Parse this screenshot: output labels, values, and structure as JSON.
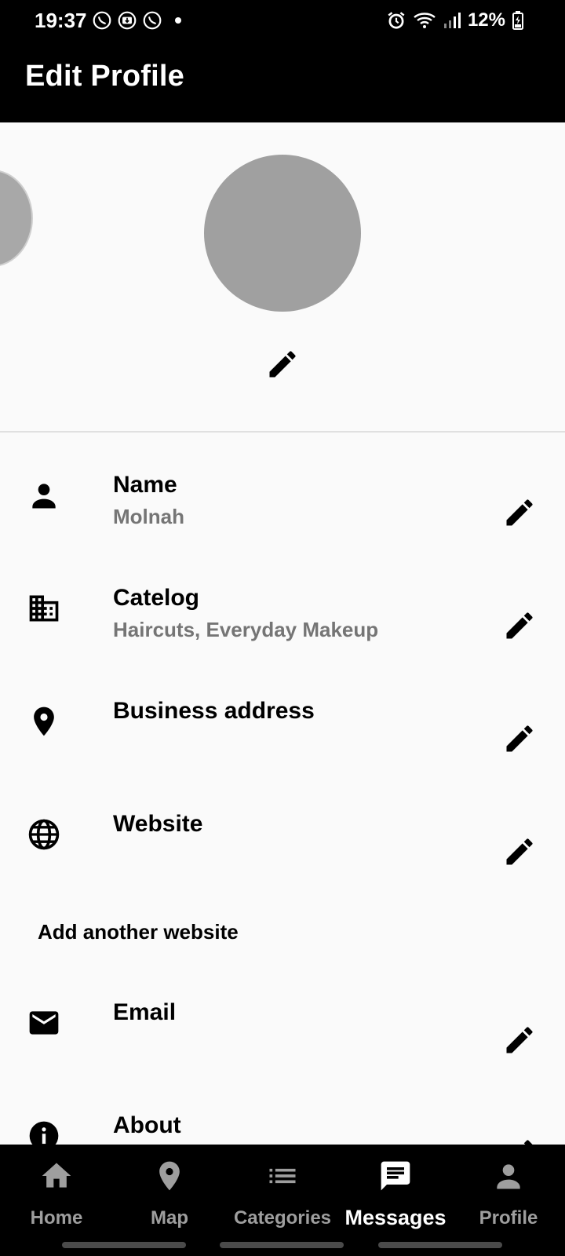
{
  "status": {
    "time": "19:37",
    "battery": "12%"
  },
  "appbar": {
    "title": "Edit Profile"
  },
  "rows": [
    {
      "id": "name",
      "title": "Name",
      "value": "Molnah",
      "icon": "person-icon"
    },
    {
      "id": "catalog",
      "title": "Catelog",
      "value": "Haircuts, Everyday Makeup",
      "icon": "building-icon"
    },
    {
      "id": "address",
      "title": "Business address",
      "value": "",
      "icon": "location-pin-icon"
    },
    {
      "id": "website",
      "title": "Website",
      "value": "",
      "icon": "globe-icon"
    },
    {
      "id": "email",
      "title": "Email",
      "value": "",
      "icon": "mail-icon"
    },
    {
      "id": "about",
      "title": "About",
      "value": "",
      "icon": "info-icon"
    }
  ],
  "add_website": "Add another website",
  "nav": {
    "items": [
      {
        "label": "Home",
        "icon": "home-icon"
      },
      {
        "label": "Map",
        "icon": "map-pin-icon"
      },
      {
        "label": "Categories",
        "icon": "list-icon"
      },
      {
        "label": "Messages",
        "icon": "chat-icon",
        "active": true
      },
      {
        "label": "Profile",
        "icon": "profile-icon"
      }
    ]
  },
  "colors": {
    "bar_bg": "#000000",
    "page_bg": "#fafafa",
    "avatar": "#a0a0a0",
    "secondary_text": "#757575",
    "nav_inactive": "#9e9e9e"
  }
}
